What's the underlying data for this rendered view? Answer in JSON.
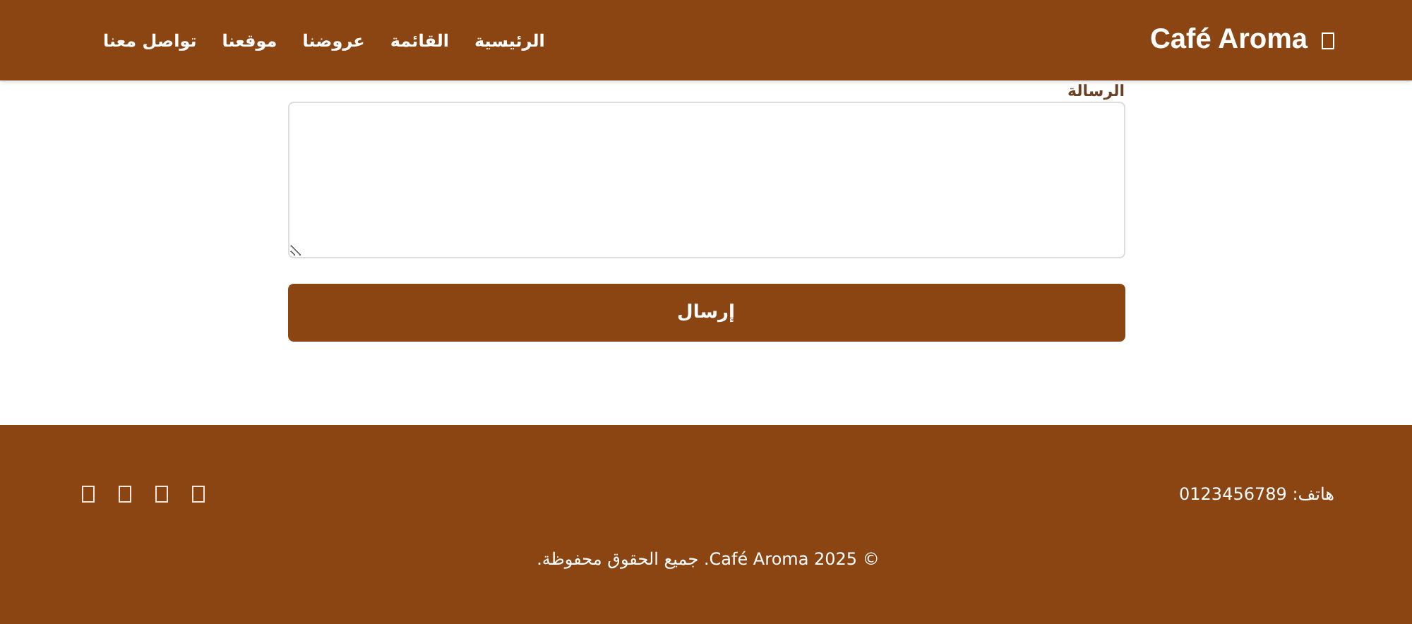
{
  "header": {
    "logo": "Café Aroma",
    "nav": [
      {
        "label": "الرئيسية"
      },
      {
        "label": "القائمة"
      },
      {
        "label": "عروضنا"
      },
      {
        "label": "موقعنا"
      },
      {
        "label": "تواصل معنا"
      }
    ]
  },
  "form": {
    "label": "الرسالة",
    "button": "إرسال"
  },
  "footer": {
    "phone": "هاتف: 0123456789",
    "copyright": "© 2025 Café Aroma. جميع الحقوق محفوظة."
  }
}
